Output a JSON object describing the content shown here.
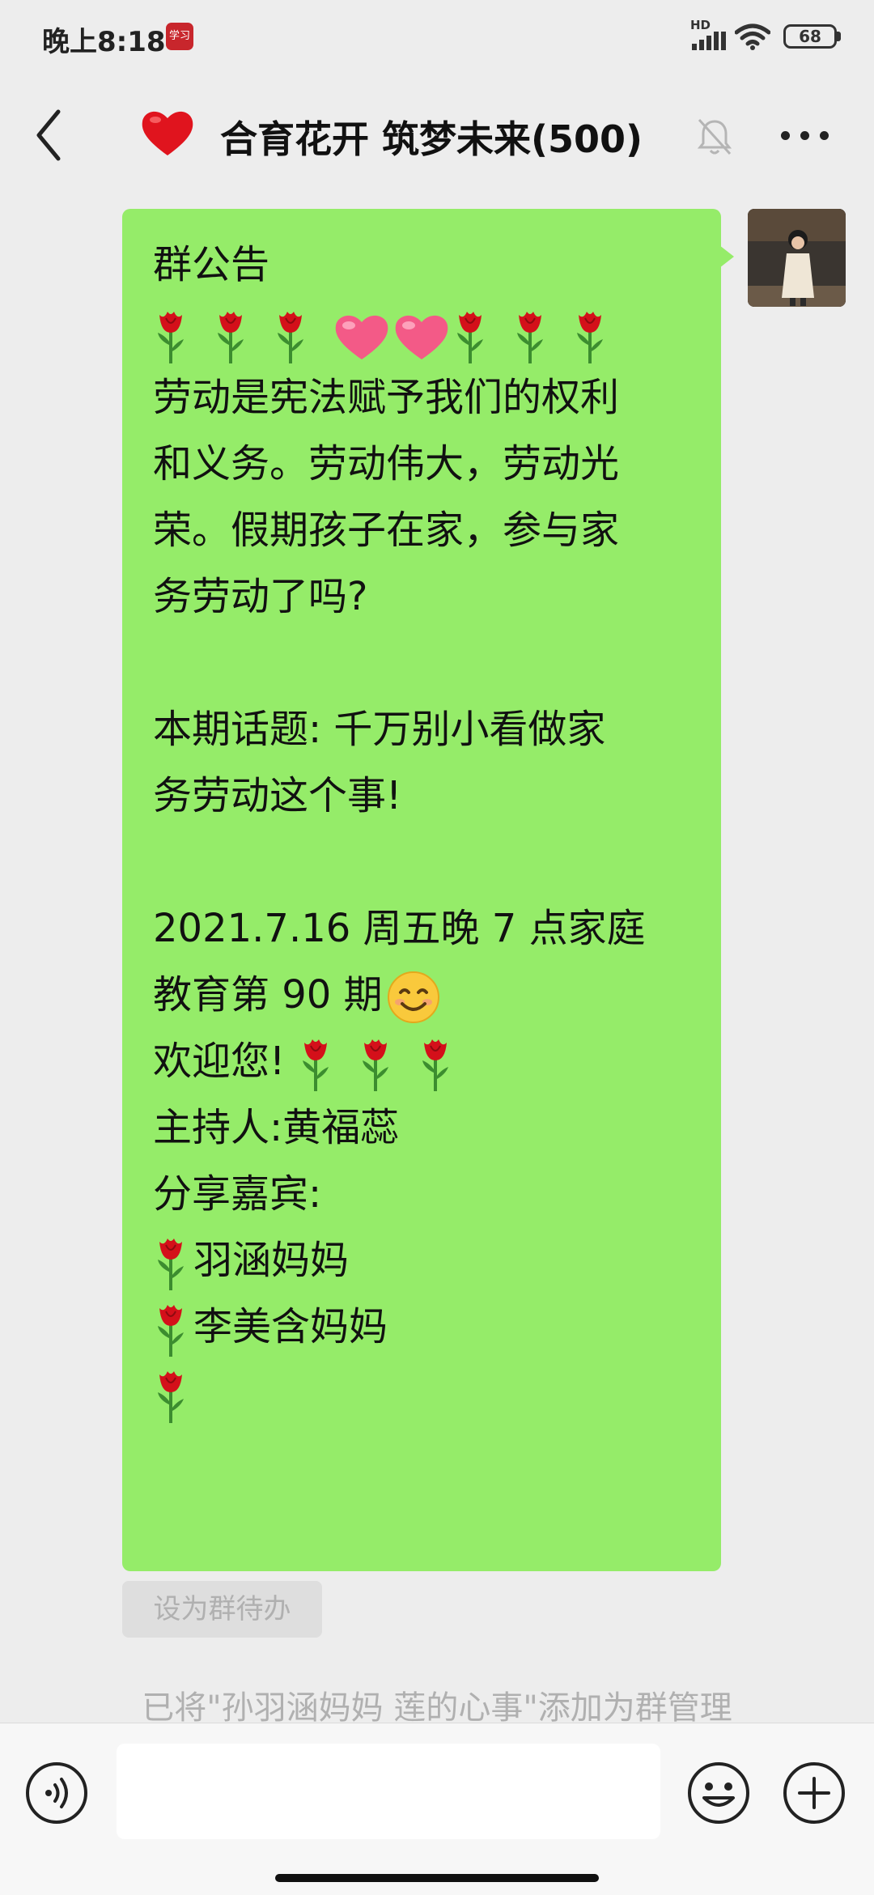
{
  "status_bar": {
    "time": "晚上8:18",
    "app_badge": "学习",
    "network": "HD",
    "battery": "68"
  },
  "header": {
    "title": "合育花开 筑梦未来(500)",
    "title_emoji": "red-heart",
    "muted": true
  },
  "message": {
    "heading": "群公告",
    "emoji_row": [
      "rose",
      "rose",
      "rose",
      "heart",
      "heart",
      "rose",
      "rose",
      "rose"
    ],
    "paragraph1": [
      "劳动是宪法赋予我们的权利",
      "和义务。劳动伟大，劳动光",
      "荣。假期孩子在家，参与家",
      "务劳动了吗?"
    ],
    "topic": [
      "本期话题: 千万别小看做家",
      "务劳动这个事!"
    ],
    "date_line": "2021.7.16 周五晚 7 点家庭",
    "issue_line": "教育第 90 期",
    "welcome": "欢迎您!",
    "host": "主持人:黄福蕊",
    "guests_label": "分享嘉宾:",
    "guests": [
      "羽涵妈妈",
      "李美含妈妈",
      ""
    ]
  },
  "set_todo_label": "设为群待办",
  "system_message": "已将\"孙羽涵妈妈  莲的心事\"添加为群管理",
  "colors": {
    "bubble": "#95ec69",
    "background": "#ededed",
    "muted_text": "#b0b0b0"
  }
}
